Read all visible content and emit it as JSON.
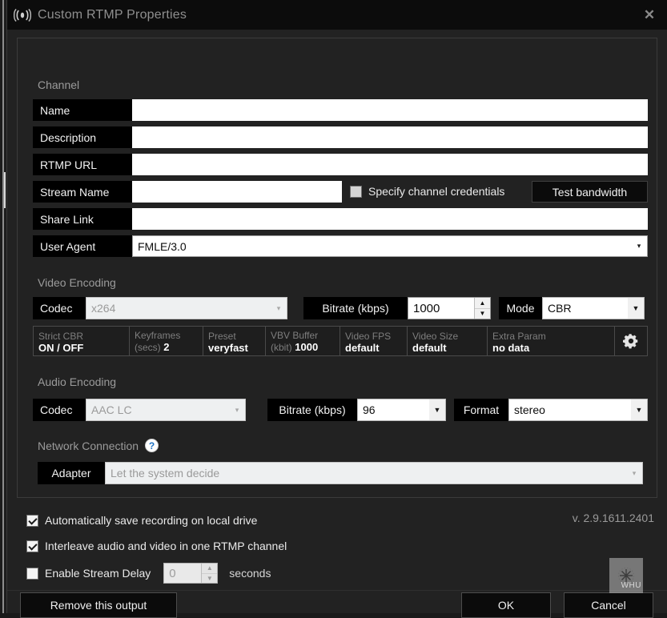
{
  "window": {
    "title": "Custom RTMP Properties",
    "icon": "broadcast-icon",
    "close_label": "✕",
    "version": "v. 2.9.1611.2401"
  },
  "sections": {
    "channel": {
      "title": "Channel"
    },
    "video": {
      "title": "Video Encoding"
    },
    "audio": {
      "title": "Audio Encoding"
    },
    "network": {
      "title": "Network Connection",
      "help_icon": "help-question-icon"
    }
  },
  "channel": {
    "name": {
      "label": "Name",
      "value": "",
      "placeholder": ""
    },
    "description": {
      "label": "Description",
      "value": "",
      "placeholder": ""
    },
    "rtmp_url": {
      "label": "RTMP URL",
      "value": "",
      "placeholder": ""
    },
    "stream_name": {
      "label": "Stream Name",
      "value": "",
      "placeholder": ""
    },
    "specify_credentials": {
      "label": "Specify channel credentials",
      "checked": false
    },
    "test_bandwidth": {
      "label": "Test bandwidth"
    },
    "share_link": {
      "label": "Share Link",
      "value": "",
      "placeholder": ""
    },
    "user_agent": {
      "label": "User Agent",
      "value": "FMLE/3.0",
      "arrow": "▾"
    }
  },
  "video": {
    "codec": {
      "label": "Codec",
      "value": "x264",
      "arrow": "▾",
      "disabled": true
    },
    "bitrate": {
      "label": "Bitrate (kbps)",
      "value": "1000",
      "up": "▲",
      "down": "▼"
    },
    "mode": {
      "label": "Mode",
      "value": "CBR",
      "arrow": "▼"
    },
    "stats": [
      {
        "key": "Strict CBR",
        "value": "ON / OFF",
        "layout": "stacked"
      },
      {
        "key": "Keyframes",
        "key2": "(secs)",
        "value": "2",
        "layout": "inline"
      },
      {
        "key": "Preset",
        "value": "veryfast",
        "layout": "stacked"
      },
      {
        "key": "VBV Buffer",
        "key2": "(kbit)",
        "value": "1000",
        "layout": "inline"
      },
      {
        "key": "Video FPS",
        "value": "default",
        "layout": "stacked"
      },
      {
        "key": "Video Size",
        "value": "default",
        "layout": "stacked"
      },
      {
        "key": "Extra Param",
        "value": "no data",
        "layout": "stacked"
      }
    ],
    "settings_button": {
      "icon": "gear-icon"
    }
  },
  "audio": {
    "codec": {
      "label": "Codec",
      "value": "AAC LC",
      "arrow": "▾",
      "disabled": true
    },
    "bitrate": {
      "label": "Bitrate (kbps)",
      "value": "96",
      "arrow": "▼"
    },
    "format": {
      "label": "Format",
      "value": "stereo",
      "arrow": "▼"
    }
  },
  "network": {
    "adapter": {
      "label": "Adapter",
      "value": "Let the system decide",
      "arrow": "▾",
      "disabled": true
    }
  },
  "options": {
    "auto_save": {
      "label": "Automatically save recording on local drive",
      "checked": true
    },
    "interleave": {
      "label": "Interleave audio and video in one RTMP channel",
      "checked": true
    },
    "stream_delay": {
      "label": "Enable Stream Delay",
      "checked": false,
      "value": "0",
      "unit": "seconds",
      "up": "▲",
      "down": "▼"
    }
  },
  "footer": {
    "remove_output": "Remove this output",
    "ok": "OK",
    "cancel": "Cancel",
    "artifact_text": "WHU"
  }
}
